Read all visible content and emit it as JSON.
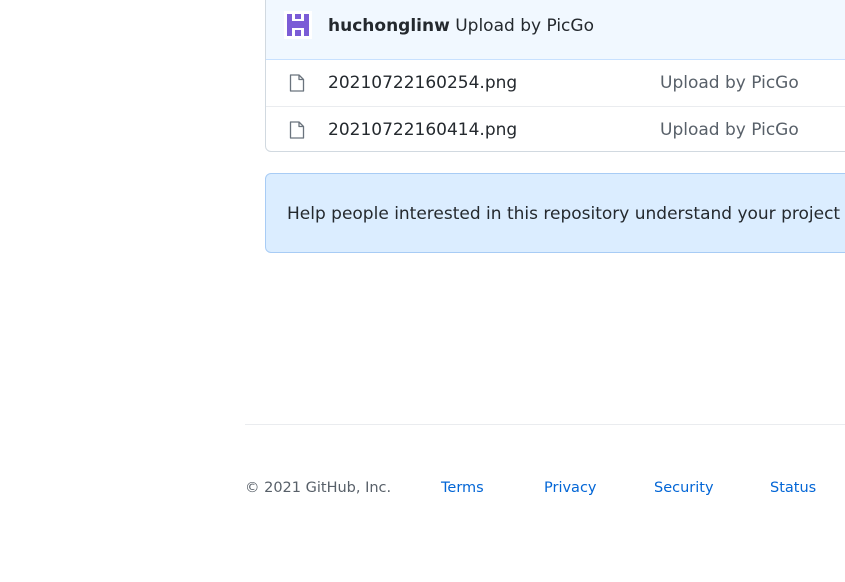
{
  "latest_commit": {
    "author": "huchonglinw",
    "message": "Upload by PicGo",
    "avatar_color": "#7b5cd6"
  },
  "files": [
    {
      "name": "20210722160254.png",
      "commit_message": "Upload by PicGo",
      "icon": "file-icon"
    },
    {
      "name": "20210722160414.png",
      "commit_message": "Upload by PicGo",
      "icon": "file-icon"
    }
  ],
  "readme_prompt": {
    "text": "Help people interested in this repository understand your project by adding a README."
  },
  "footer": {
    "copyright": "© 2021 GitHub, Inc.",
    "links": [
      "Terms",
      "Privacy",
      "Security",
      "Status"
    ]
  },
  "colors": {
    "link": "#0366d6",
    "commit_header_bg": "#f1f8ff",
    "readme_bg": "#dbedff"
  }
}
